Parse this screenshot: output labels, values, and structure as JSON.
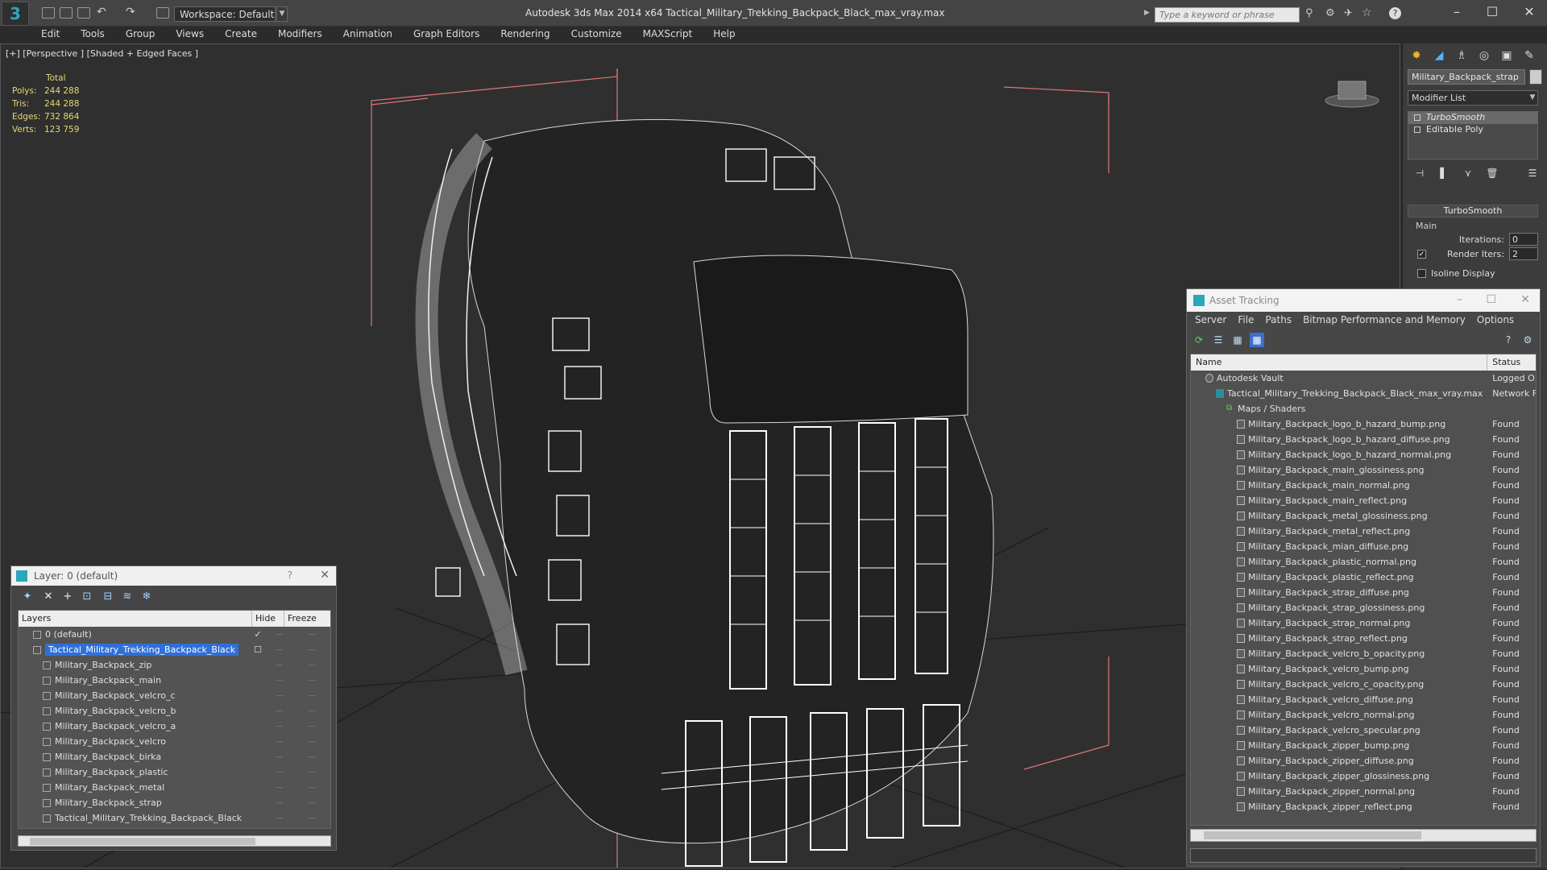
{
  "titlebar": {
    "app_title": "Autodesk 3ds Max  2014 x64      Tactical_Military_Trekking_Backpack_Black_max_vray.max",
    "workspace": "Workspace: Default",
    "search_placeholder": "Type a keyword or phrase"
  },
  "menu": [
    "Edit",
    "Tools",
    "Group",
    "Views",
    "Create",
    "Modifiers",
    "Animation",
    "Graph Editors",
    "Rendering",
    "Customize",
    "MAXScript",
    "Help"
  ],
  "viewport": {
    "label": "[+] [Perspective ] [Shaded + Edged Faces ]",
    "stats": {
      "header": "Total",
      "rows": [
        {
          "k": "Polys:",
          "v": "244 288"
        },
        {
          "k": "Tris:",
          "v": "244 288"
        },
        {
          "k": "Edges:",
          "v": "732 864"
        },
        {
          "k": "Verts:",
          "v": "123 759"
        }
      ]
    }
  },
  "command_panel": {
    "object_name": "Military_Backpack_strap",
    "modifier_list": "Modifier List",
    "stack": [
      "TurboSmooth",
      "Editable Poly"
    ],
    "rollout_title": "TurboSmooth",
    "group_label": "Main",
    "iterations_label": "Iterations:",
    "iterations_value": "0",
    "render_iters_label": "Render Iters:",
    "render_iters_value": "2",
    "isoline_label": "Isoline Display"
  },
  "layer_window": {
    "title": "Layer: 0 (default)",
    "help": "?",
    "columns": [
      "Layers",
      "Hide",
      "Freeze"
    ],
    "rows": [
      {
        "name": "0 (default)",
        "level": 1,
        "checked": true,
        "selected": false
      },
      {
        "name": "Tactical_Military_Trekking_Backpack_Black",
        "level": 1,
        "checked": false,
        "selected": true
      },
      {
        "name": "Military_Backpack_zip",
        "level": 2,
        "selected": false
      },
      {
        "name": "Military_Backpack_main",
        "level": 2,
        "selected": false
      },
      {
        "name": "Military_Backpack_velcro_c",
        "level": 2,
        "selected": false
      },
      {
        "name": "Military_Backpack_velcro_b",
        "level": 2,
        "selected": false
      },
      {
        "name": "Military_Backpack_velcro_a",
        "level": 2,
        "selected": false
      },
      {
        "name": "Military_Backpack_velcro",
        "level": 2,
        "selected": false
      },
      {
        "name": "Military_Backpack_birka",
        "level": 2,
        "selected": false
      },
      {
        "name": "Military_Backpack_plastic",
        "level": 2,
        "selected": false
      },
      {
        "name": "Military_Backpack_metal",
        "level": 2,
        "selected": false
      },
      {
        "name": "Military_Backpack_strap",
        "level": 2,
        "selected": false
      },
      {
        "name": "Tactical_Military_Trekking_Backpack_Black",
        "level": 2,
        "selected": false
      }
    ]
  },
  "asset_window": {
    "title": "Asset Tracking",
    "menu": [
      "Server",
      "File",
      "Paths",
      "Bitmap Performance and Memory",
      "Options"
    ],
    "columns": [
      "Name",
      "Status"
    ],
    "rows": [
      {
        "name": "Autodesk Vault",
        "status": "Logged O",
        "level": 1,
        "icon": "vault"
      },
      {
        "name": "Tactical_Military_Trekking_Backpack_Black_max_vray.max",
        "status": "Network F",
        "level": 2,
        "icon": "max"
      },
      {
        "name": "Maps / Shaders",
        "status": "",
        "level": 3,
        "icon": "maps"
      },
      {
        "name": "Military_Backpack_logo_b_hazard_bump.png",
        "status": "Found",
        "level": 4,
        "icon": "file"
      },
      {
        "name": "Military_Backpack_logo_b_hazard_diffuse.png",
        "status": "Found",
        "level": 4,
        "icon": "file"
      },
      {
        "name": "Military_Backpack_logo_b_hazard_normal.png",
        "status": "Found",
        "level": 4,
        "icon": "file"
      },
      {
        "name": "Military_Backpack_main_glossiness.png",
        "status": "Found",
        "level": 4,
        "icon": "file"
      },
      {
        "name": "Military_Backpack_main_normal.png",
        "status": "Found",
        "level": 4,
        "icon": "file"
      },
      {
        "name": "Military_Backpack_main_reflect.png",
        "status": "Found",
        "level": 4,
        "icon": "file"
      },
      {
        "name": "Military_Backpack_metal_glossiness.png",
        "status": "Found",
        "level": 4,
        "icon": "file"
      },
      {
        "name": "Military_Backpack_metal_reflect.png",
        "status": "Found",
        "level": 4,
        "icon": "file"
      },
      {
        "name": "Military_Backpack_mian_diffuse.png",
        "status": "Found",
        "level": 4,
        "icon": "file"
      },
      {
        "name": "Military_Backpack_plastic_normal.png",
        "status": "Found",
        "level": 4,
        "icon": "file"
      },
      {
        "name": "Military_Backpack_plastic_reflect.png",
        "status": "Found",
        "level": 4,
        "icon": "file"
      },
      {
        "name": "Military_Backpack_strap_diffuse.png",
        "status": "Found",
        "level": 4,
        "icon": "file"
      },
      {
        "name": "Military_Backpack_strap_glossiness.png",
        "status": "Found",
        "level": 4,
        "icon": "file"
      },
      {
        "name": "Military_Backpack_strap_normal.png",
        "status": "Found",
        "level": 4,
        "icon": "file"
      },
      {
        "name": "Military_Backpack_strap_reflect.png",
        "status": "Found",
        "level": 4,
        "icon": "file"
      },
      {
        "name": "Military_Backpack_velcro_b_opacity.png",
        "status": "Found",
        "level": 4,
        "icon": "file"
      },
      {
        "name": "Military_Backpack_velcro_bump.png",
        "status": "Found",
        "level": 4,
        "icon": "file"
      },
      {
        "name": "Military_Backpack_velcro_c_opacity.png",
        "status": "Found",
        "level": 4,
        "icon": "file"
      },
      {
        "name": "Military_Backpack_velcro_diffuse.png",
        "status": "Found",
        "level": 4,
        "icon": "file"
      },
      {
        "name": "Military_Backpack_velcro_normal.png",
        "status": "Found",
        "level": 4,
        "icon": "file"
      },
      {
        "name": "Military_Backpack_velcro_specular.png",
        "status": "Found",
        "level": 4,
        "icon": "file"
      },
      {
        "name": "Military_Backpack_zipper_bump.png",
        "status": "Found",
        "level": 4,
        "icon": "file"
      },
      {
        "name": "Military_Backpack_zipper_diffuse.png",
        "status": "Found",
        "level": 4,
        "icon": "file"
      },
      {
        "name": "Military_Backpack_zipper_glossiness.png",
        "status": "Found",
        "level": 4,
        "icon": "file"
      },
      {
        "name": "Military_Backpack_zipper_normal.png",
        "status": "Found",
        "level": 4,
        "icon": "file"
      },
      {
        "name": "Military_Backpack_zipper_reflect.png",
        "status": "Found",
        "level": 4,
        "icon": "file"
      }
    ]
  }
}
